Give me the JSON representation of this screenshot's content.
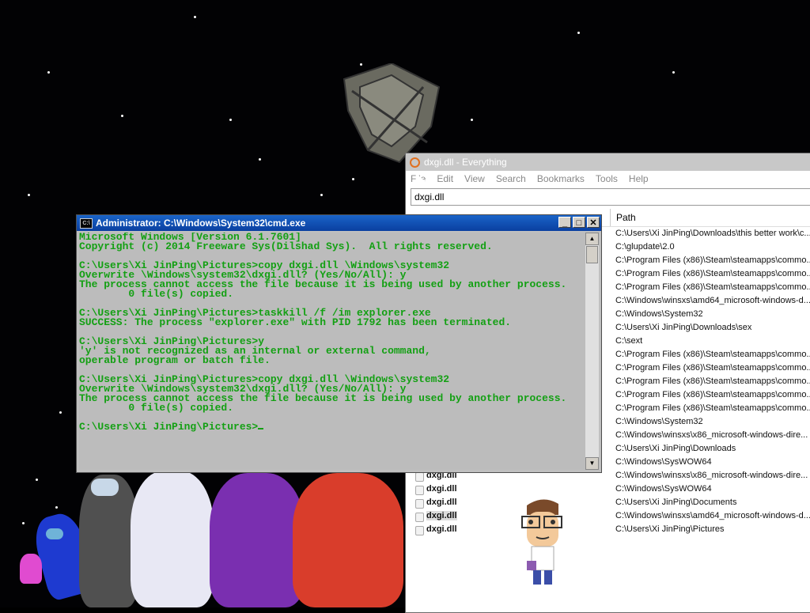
{
  "cmd": {
    "title": "Administrator: C:\\Windows\\System32\\cmd.exe",
    "icon": "C:\\",
    "min": "_",
    "max": "□",
    "close": "✕",
    "up": "▲",
    "down": "▼",
    "lines": [
      "Microsoft Windows [Version 6.1.7601]",
      "Copyright (c) 2014 Freeware Sys(Dilshad Sys).  All rights reserved.",
      "",
      "C:\\Users\\Xi JinPing\\Pictures>copy dxgi.dll \\Windows\\system32",
      "Overwrite \\Windows\\system32\\dxgi.dll? (Yes/No/All): y",
      "The process cannot access the file because it is being used by another process.",
      "        0 file(s) copied.",
      "",
      "C:\\Users\\Xi JinPing\\Pictures>taskkill /f /im explorer.exe",
      "SUCCESS: The process \"explorer.exe\" with PID 1792 has been terminated.",
      "",
      "C:\\Users\\Xi JinPing\\Pictures>y",
      "'y' is not recognized as an internal or external command,",
      "operable program or batch file.",
      "",
      "C:\\Users\\Xi JinPing\\Pictures>copy dxgi.dll \\Windows\\system32",
      "Overwrite \\Windows\\system32\\dxgi.dll? (Yes/No/All): y",
      "The process cannot access the file because it is being used by another process.",
      "        0 file(s) copied.",
      ""
    ],
    "prompt": "C:\\Users\\Xi JinPing\\Pictures>"
  },
  "everything": {
    "title": "dxgi.dll - Everything",
    "menu": [
      "File",
      "Edit",
      "View",
      "Search",
      "Bookmarks",
      "Tools",
      "Help"
    ],
    "search_value": "dxgi.dll",
    "col_path": "Path",
    "rows": [
      {
        "name": "",
        "path": "C:\\Users\\Xi JinPing\\Downloads\\this better work\\c..."
      },
      {
        "name": "",
        "path": "C:\\glupdate\\2.0"
      },
      {
        "name": "",
        "path": "C:\\Program Files (x86)\\Steam\\steamapps\\commo..."
      },
      {
        "name": "",
        "path": "C:\\Program Files (x86)\\Steam\\steamapps\\commo..."
      },
      {
        "name": "",
        "path": "C:\\Program Files (x86)\\Steam\\steamapps\\commo..."
      },
      {
        "name": "",
        "path": "C:\\Windows\\winsxs\\amd64_microsoft-windows-d..."
      },
      {
        "name": "",
        "path": "C:\\Windows\\System32"
      },
      {
        "name": "",
        "path": "C:\\Users\\Xi JinPing\\Downloads\\sex"
      },
      {
        "name": "",
        "path": "C:\\sext"
      },
      {
        "name": "",
        "path": "C:\\Program Files (x86)\\Steam\\steamapps\\commo..."
      },
      {
        "name": "",
        "path": "C:\\Program Files (x86)\\Steam\\steamapps\\commo..."
      },
      {
        "name": "",
        "path": "C:\\Program Files (x86)\\Steam\\steamapps\\commo..."
      },
      {
        "name": "",
        "path": "C:\\Program Files (x86)\\Steam\\steamapps\\commo..."
      },
      {
        "name": "",
        "path": "C:\\Program Files (x86)\\Steam\\steamapps\\commo..."
      },
      {
        "name": "",
        "path": "C:\\Windows\\System32"
      },
      {
        "name": "",
        "path": "C:\\Windows\\winsxs\\x86_microsoft-windows-dire..."
      },
      {
        "name": "",
        "path": "C:\\Users\\Xi JinPing\\Downloads"
      },
      {
        "name": "",
        "path": "C:\\Windows\\SysWOW64"
      },
      {
        "name": "dxgi.dll",
        "path": "C:\\Windows\\winsxs\\x86_microsoft-windows-dire..."
      },
      {
        "name": "dxgi.dll",
        "path": "C:\\Windows\\SysWOW64"
      },
      {
        "name": "dxgi.dll",
        "path": "C:\\Users\\Xi JinPing\\Documents"
      },
      {
        "name": "dxgi.dll",
        "path": "C:\\Windows\\winsxs\\amd64_microsoft-windows-d..."
      },
      {
        "name": "dxgi.dll",
        "path": "C:\\Users\\Xi JinPing\\Pictures"
      }
    ]
  },
  "colors": {
    "console_text": "#13a013",
    "console_bg": "#bcbcbc",
    "titlebar": "#0a3fa0"
  }
}
